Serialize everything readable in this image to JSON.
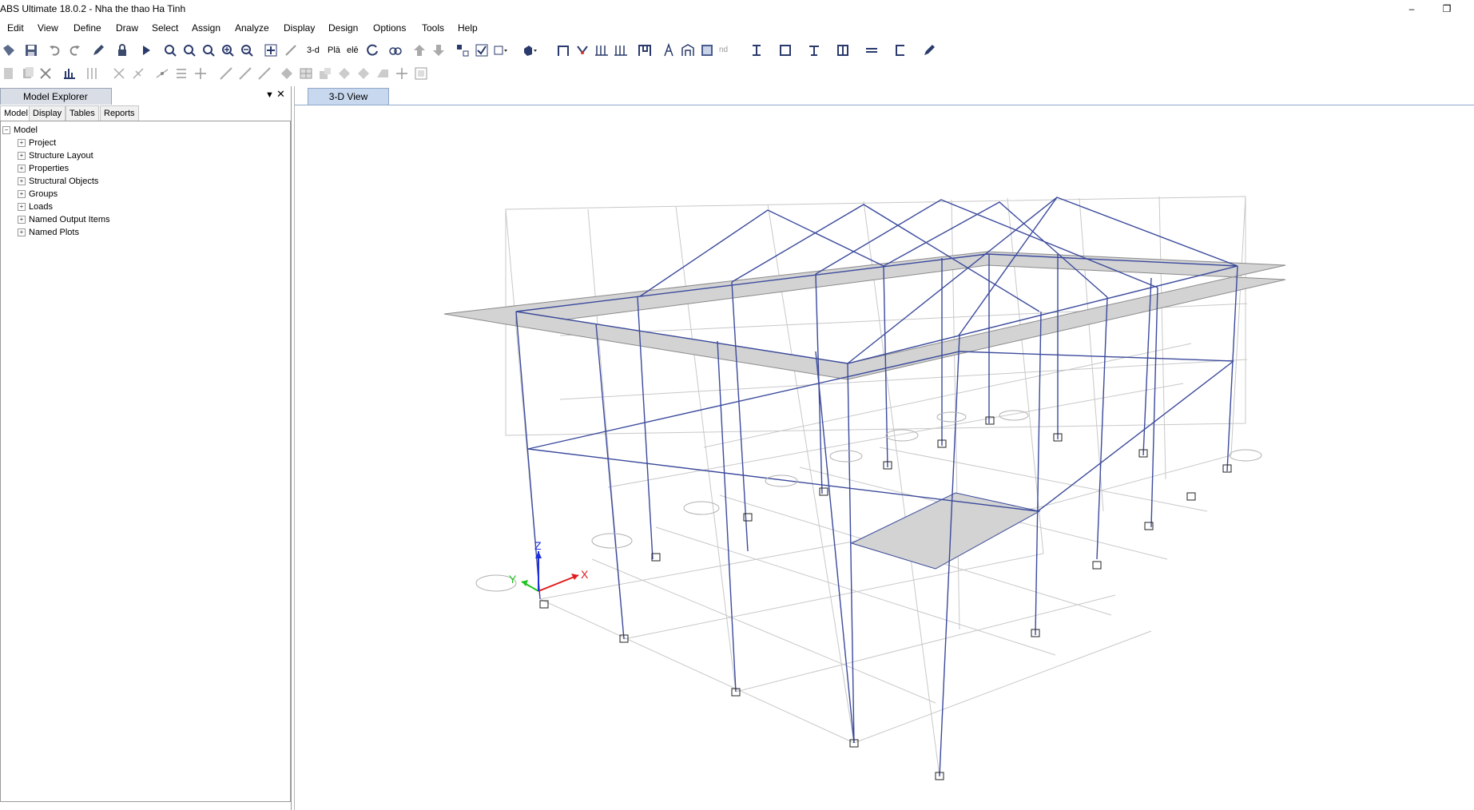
{
  "app": {
    "title": "ABS Ultimate 18.0.2 - Nha the thao Ha Tinh"
  },
  "window_controls": {
    "minimize": "–",
    "restore": "❐"
  },
  "menu": [
    "Edit",
    "View",
    "Define",
    "Draw",
    "Select",
    "Assign",
    "Analyze",
    "Display",
    "Design",
    "Options",
    "Tools",
    "Help"
  ],
  "model_explorer": {
    "title": "Model Explorer",
    "tabs": [
      "Model",
      "Display",
      "Tables",
      "Reports"
    ],
    "active_tab": "Model",
    "tree_root": "Model",
    "tree_items": [
      "Project",
      "Structure Layout",
      "Properties",
      "Structural Objects",
      "Groups",
      "Loads",
      "Named Output Items",
      "Named Plots"
    ]
  },
  "view": {
    "tab_label": "3-D View",
    "axes": {
      "x": "X",
      "y": "Y",
      "z": "Z"
    }
  },
  "toolbar": {
    "text_buttons": {
      "three_d": "3-d",
      "plan": "Plā",
      "elev": "elē",
      "nd": "nd"
    }
  },
  "colors": {
    "frame": "#3b4a9c",
    "grid": "#c8c8c8",
    "slab": "#d3d3d3",
    "axis_x": "#e01b1b",
    "axis_y": "#1ec41e",
    "axis_z": "#1b2ee0"
  }
}
